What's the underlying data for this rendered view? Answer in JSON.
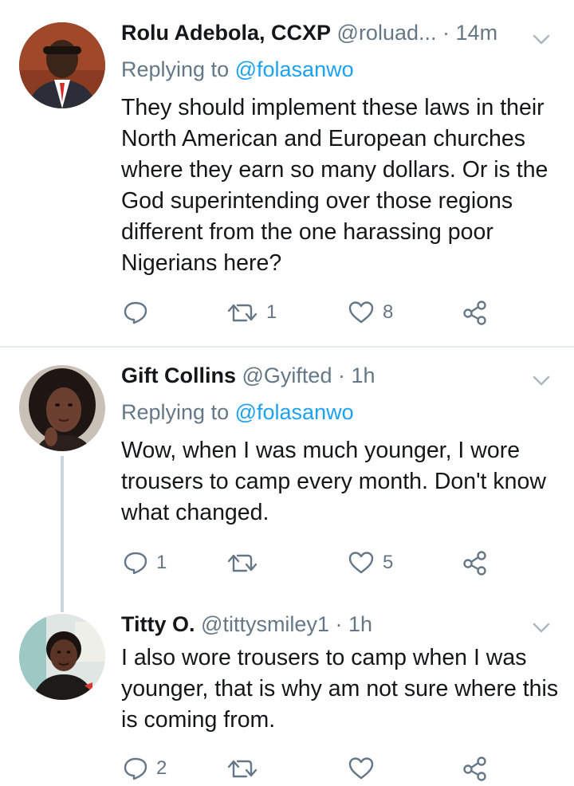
{
  "tweets": [
    {
      "name": "Rolu Adebola, CCXP",
      "handle": "@roluad...",
      "dot": "·",
      "time": "14m",
      "replying_prefix": "Replying to",
      "replying_to": "@folasanwo",
      "text": "They should implement these laws in their North American and European churches where they earn so many dollars. Or is the God superintending over those regions different from the one harassing poor Nigerians here?",
      "reply_count": "",
      "retweet_count": "1",
      "like_count": "8"
    },
    {
      "name": "Gift Collins",
      "handle": "@Gyifted",
      "dot": "·",
      "time": "1h",
      "replying_prefix": "Replying to",
      "replying_to": "@folasanwo",
      "text": "Wow, when I was much younger, I wore trousers to camp every month. Don't know what changed.",
      "reply_count": "1",
      "retweet_count": "",
      "like_count": "5"
    },
    {
      "name": "Titty O.",
      "handle": "@tittysmiley1",
      "dot": "·",
      "time": "1h",
      "text": "I also wore trousers to camp when I was younger, that is why am not sure where this is coming from.",
      "reply_count": "2",
      "retweet_count": "",
      "like_count": ""
    }
  ],
  "colors": {
    "text": "#14171a",
    "muted": "#657786",
    "link": "#1da1f2",
    "divider": "#e6ecf0",
    "thread": "#ccd6dd"
  },
  "icons": [
    "reply-icon",
    "retweet-icon",
    "like-icon",
    "share-icon",
    "chevron-down-icon"
  ]
}
